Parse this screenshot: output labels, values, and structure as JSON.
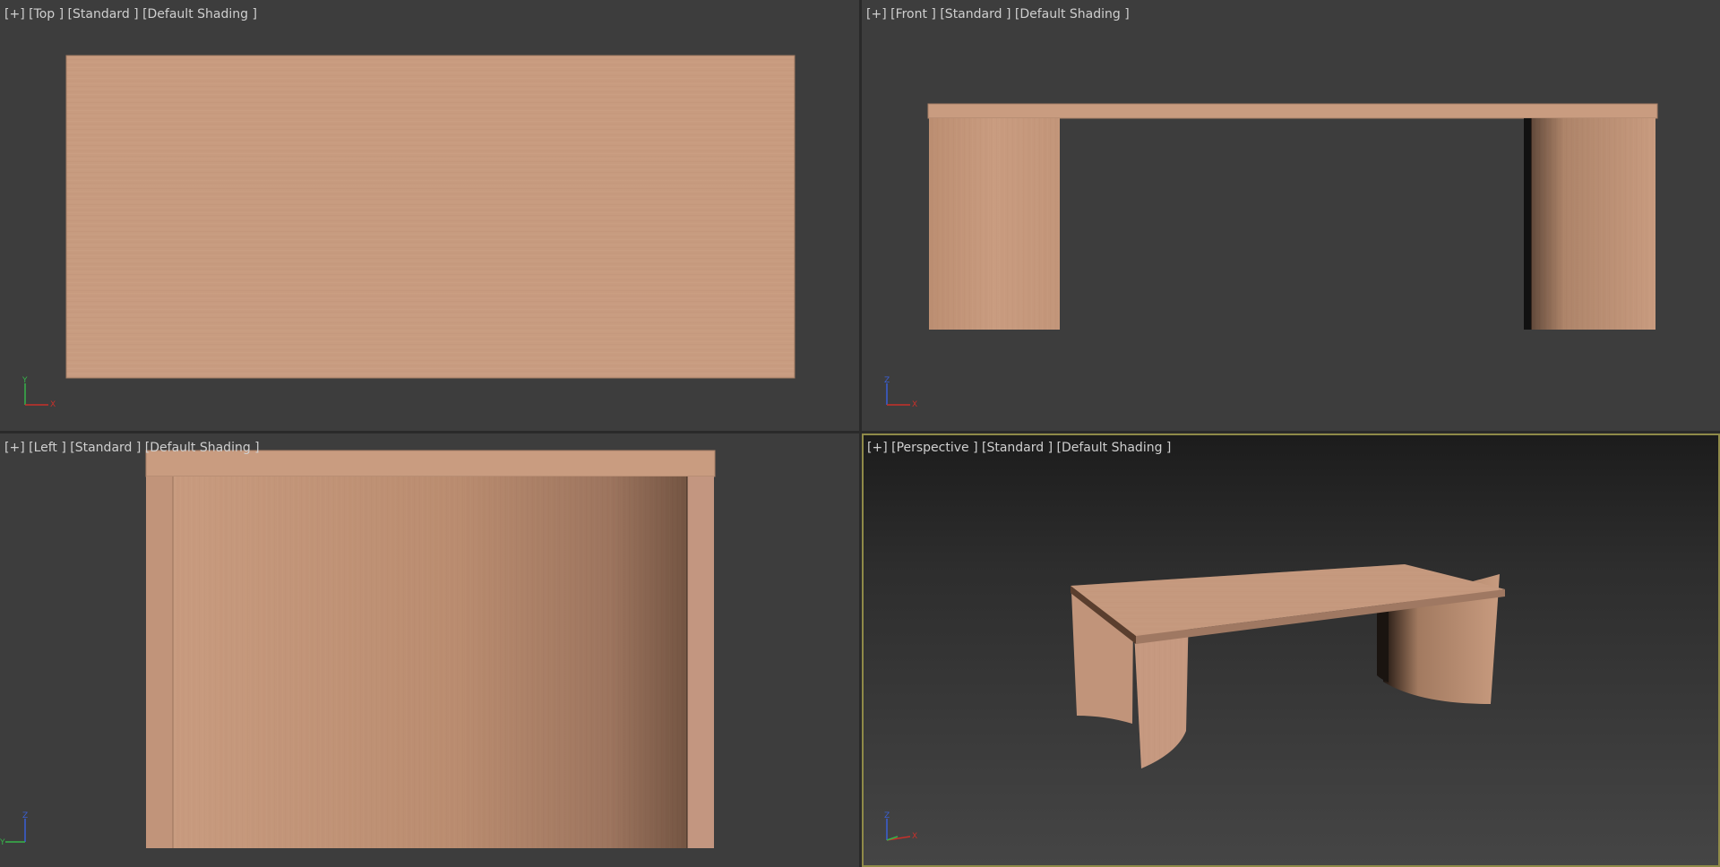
{
  "viewports": {
    "top": {
      "label": "[+] [Top ] [Standard ] [Default Shading ]",
      "active": false
    },
    "front": {
      "label": "[+] [Front ] [Standard ] [Default Shading ]",
      "active": false
    },
    "left": {
      "label": "[+] [Left ] [Standard ] [Default Shading ]",
      "active": false
    },
    "perspective": {
      "label": "[+] [Perspective ] [Standard ] [Default Shading ]",
      "active": true
    }
  },
  "axes": {
    "top": {
      "v": "Y",
      "h": "X"
    },
    "front": {
      "v": "Z",
      "h": "X"
    },
    "left": {
      "v": "Z",
      "h": "Y"
    },
    "perspective": {
      "v": "Z",
      "h": "X"
    }
  },
  "colors": {
    "viewport_bg": "#3d3d3d",
    "wood_light": "#c99c80",
    "wood_mid": "#b98c70",
    "wood_dark": "#5a3e2e",
    "active_border": "#8f8a48",
    "axis_x": "#c8302a",
    "axis_y": "#37b34a",
    "axis_z": "#3a5fd6"
  }
}
